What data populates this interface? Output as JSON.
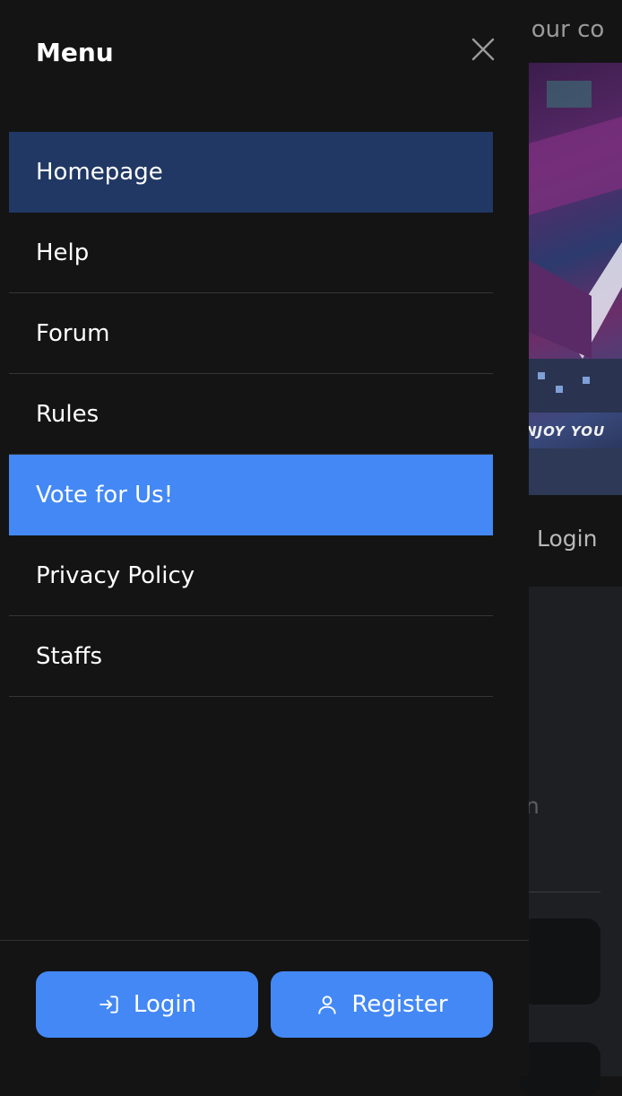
{
  "background": {
    "topbar_text": "n our co",
    "banner_tag": "NJOY YOU",
    "nav_login": "Login",
    "faded_char": "n"
  },
  "drawer": {
    "title": "Menu",
    "close_icon": "close-icon",
    "items": [
      {
        "label": "Homepage",
        "state": "active"
      },
      {
        "label": "Help",
        "state": "normal"
      },
      {
        "label": "Forum",
        "state": "normal"
      },
      {
        "label": "Rules",
        "state": "normal"
      },
      {
        "label": "Vote for Us!",
        "state": "highlight"
      },
      {
        "label": "Privacy Policy",
        "state": "normal"
      },
      {
        "label": "Staffs",
        "state": "normal"
      }
    ],
    "login_button": {
      "label": "Login",
      "icon": "login-icon"
    },
    "register_button": {
      "label": "Register",
      "icon": "user-icon"
    }
  },
  "colors": {
    "drawer_bg": "#141414",
    "active_item": "#213864",
    "accent": "#4388f5",
    "text": "#ffffff"
  }
}
